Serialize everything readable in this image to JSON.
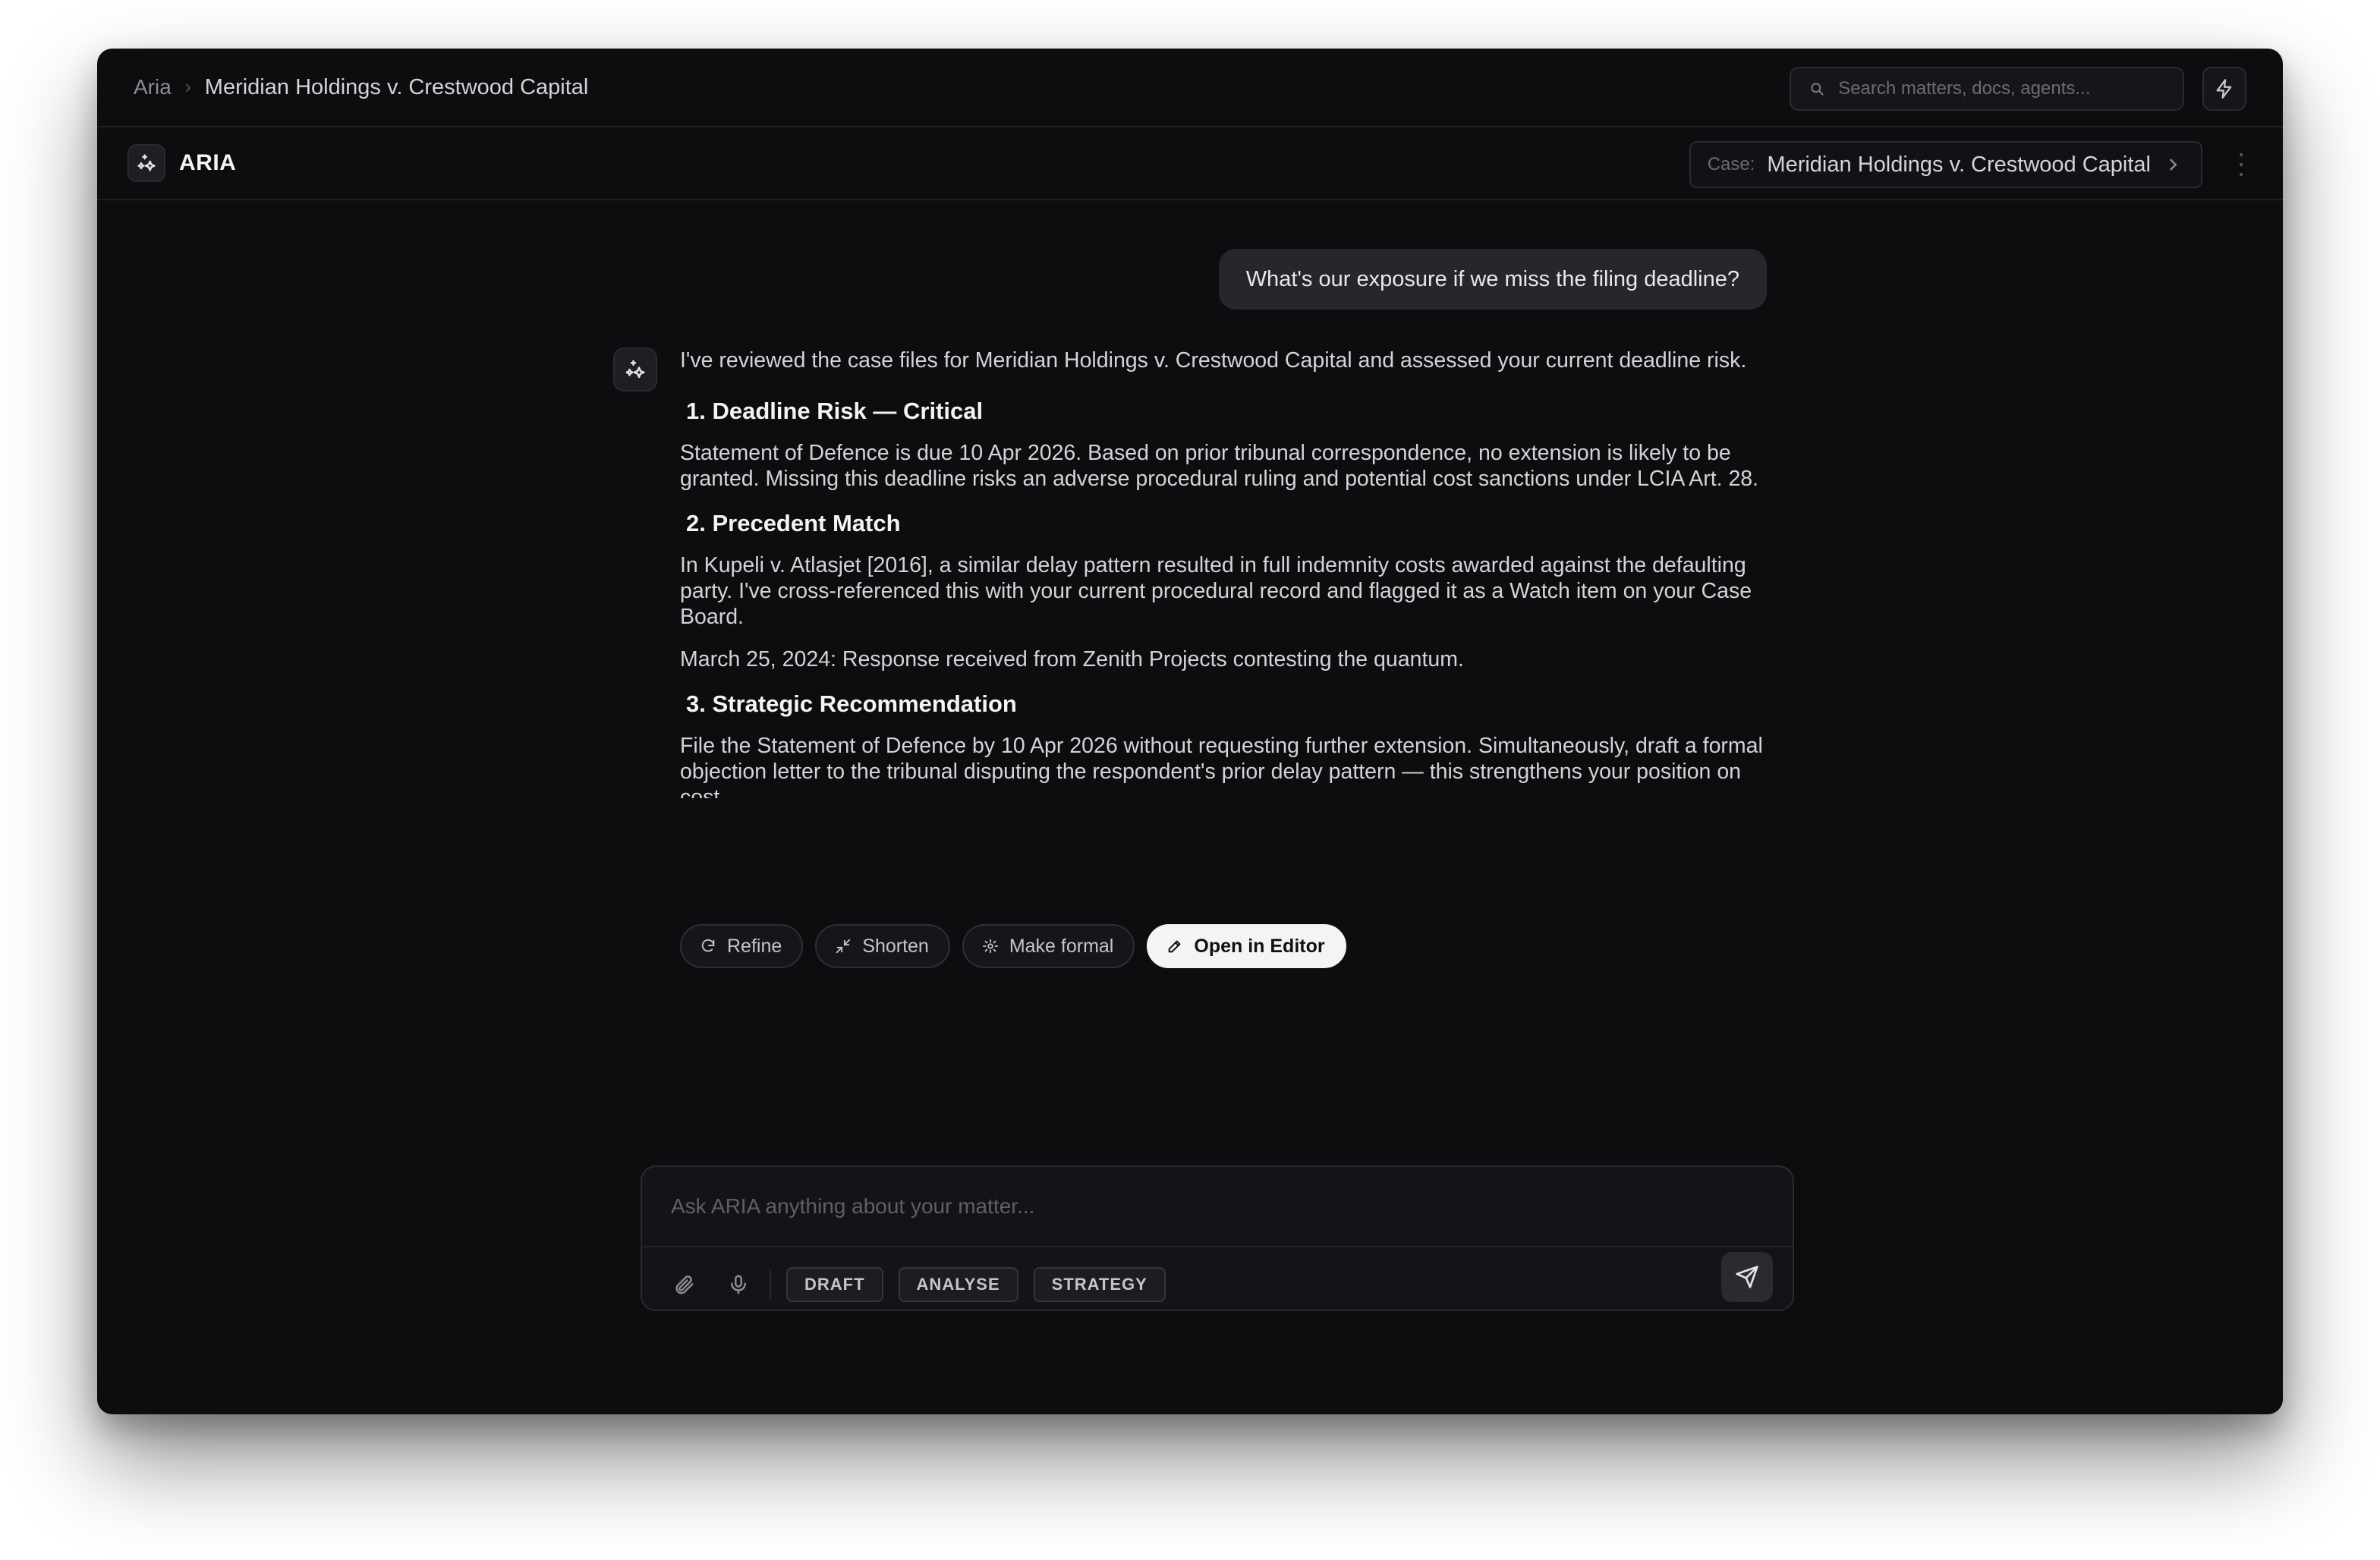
{
  "breadcrumb": {
    "root": "Aria",
    "separator": "›",
    "current": "Meridian Holdings v. Crestwood Capital"
  },
  "search": {
    "placeholder": "Search matters, docs, agents..."
  },
  "header": {
    "app_name": "ARIA",
    "case_label": "Case:",
    "case_value": "Meridian Holdings v. Crestwood Capital"
  },
  "chat": {
    "user_message": "What's our exposure if we miss the filing deadline?",
    "assistant": {
      "intro": "I've reviewed the case files for Meridian Holdings v. Crestwood Capital and assessed your current deadline risk.",
      "sections": [
        {
          "title": "1. Deadline Risk — Critical",
          "body": "Statement of Defence is due 10 Apr 2026. Based on prior tribunal correspondence, no extension is likely to be granted. Missing this deadline risks an adverse procedural ruling and potential cost sanctions under LCIA Art. 28."
        },
        {
          "title": "2. Precedent Match",
          "body": "In Kupeli v. Atlasjet [2016], a similar delay pattern resulted in full indemnity costs awarded against the defaulting party. I've cross-referenced this with your current procedural record and flagged it as a Watch item on your Case Board.",
          "body2": "March 25, 2024: Response received from Zenith Projects contesting the quantum."
        },
        {
          "title": "3. Strategic Recommendation",
          "body": "File the Statement of Defence by 10 Apr 2026 without requesting further extension. Simultaneously, draft a formal objection letter to the tribunal disputing the respondent's prior delay pattern — this strengthens your position on cost"
        }
      ]
    },
    "actions": {
      "refine": "Refine",
      "shorten": "Shorten",
      "make_formal": "Make formal",
      "open_editor": "Open in Editor"
    }
  },
  "composer": {
    "placeholder": "Ask ARIA anything about your matter...",
    "modes": [
      "DRAFT",
      "ANALYSE",
      "STRATEGY"
    ]
  },
  "colors": {
    "window_bg": "#0d0d10",
    "bubble_bg": "#26262c",
    "primary_button": "#f4f4f5"
  }
}
